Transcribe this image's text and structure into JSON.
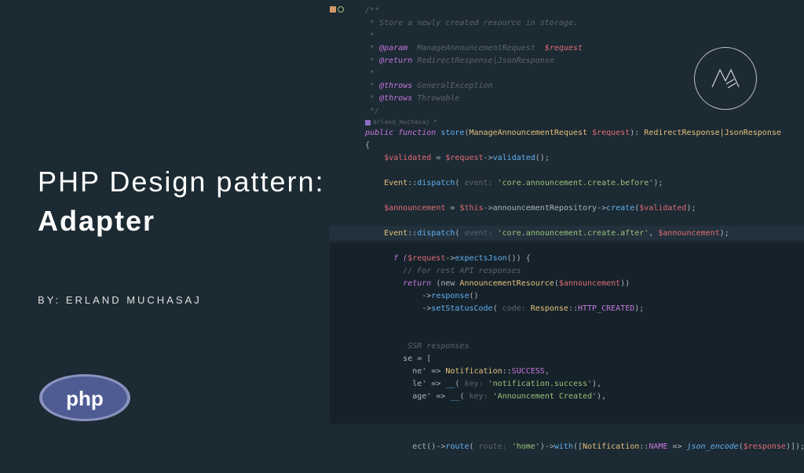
{
  "title": {
    "line1": "PHP Design pattern:",
    "line2": "Adapter"
  },
  "byline": "BY: ERLAND MUCHASAJ",
  "logo": {
    "label": "php"
  },
  "author_hint": "erland_muchasaj *",
  "code": {
    "doc_open": "/**",
    "doc_desc": " * Store a newly created resource in storage.",
    "doc_blank": " *",
    "doc_param_tag": "@param",
    "doc_param_type": "  ManageAnnouncementRequest  ",
    "doc_param_var": "$request",
    "doc_return_tag": "@return",
    "doc_return_type": " RedirectResponse|JsonResponse",
    "doc_throws_tag": "@throws",
    "doc_throws_type1": " GeneralException",
    "doc_throws_type2": " Throwable",
    "doc_close": " */",
    "fn_vis": "public",
    "fn_kw": " function ",
    "fn_name": "store",
    "fn_paren_open": "(",
    "fn_param_type": "ManageAnnouncementRequest ",
    "fn_param_var": "$request",
    "fn_paren_close": ")",
    "fn_ret_colon": ": ",
    "fn_ret_type": "RedirectResponse|JsonResponse",
    "brace_open": "{",
    "l_validated_var": "$validated",
    "l_eq": " = ",
    "l_request": "$request",
    "l_arrow": "->",
    "l_validated_call": "validated",
    "l_parens_semi": "();",
    "l_event_class": "Event",
    "l_static": "::",
    "l_dispatch": "dispatch",
    "l_hint_event": " event: ",
    "l_str_before": "'core.announcement.create.before'",
    "l_close_semi": ");",
    "l_announcement_var": "$announcement",
    "l_this": "$this",
    "l_repo": "announcementRepository",
    "l_create": "create",
    "l_open_validated": "(",
    "l_str_after": "'core.announcement.create.after'",
    "l_comma_sp": ", ",
    "l_if_open": "f (",
    "l_expects": "expectsJson",
    "l_parens": "()",
    "l_if_close": ") {",
    "l_api_comment": "// For rest API responses",
    "l_return": "return",
    "l_new": " (new ",
    "l_res_class": "AnnouncementResource",
    "l_response_call": "response",
    "l_setstatus": "setStatusCode",
    "l_hint_code": " code: ",
    "l_response_class": "Response",
    "l_http_created": "HTTP_CREATED",
    "l_ssr_comment": " SSR responses",
    "l_se_open": "se = [",
    "l_ne_arrow": "ne' => ",
    "l_notif_class": "Notification",
    "l_success": "SUCCESS",
    "l_comma": ",",
    "l_le_arrow": "le' => ",
    "l_trans": "__",
    "l_hint_key": " key: ",
    "l_str_notif_success": "'notification.success'",
    "l_close_paren_comma": "),",
    "l_age_arrow": "age' => ",
    "l_str_ann_created": "'Announcement Created'",
    "l_ect_open": "ect()->",
    "l_route": "route",
    "l_hint_route": " route: ",
    "l_str_home": "'home'",
    "l_close_arrow": ")->",
    "l_with": "with",
    "l_with_open": "([",
    "l_name_const": "NAME",
    "l_fat_arrow": " => ",
    "l_json_encode": "json_encode",
    "l_response_var": "$response",
    "l_with_close": ")]);"
  }
}
